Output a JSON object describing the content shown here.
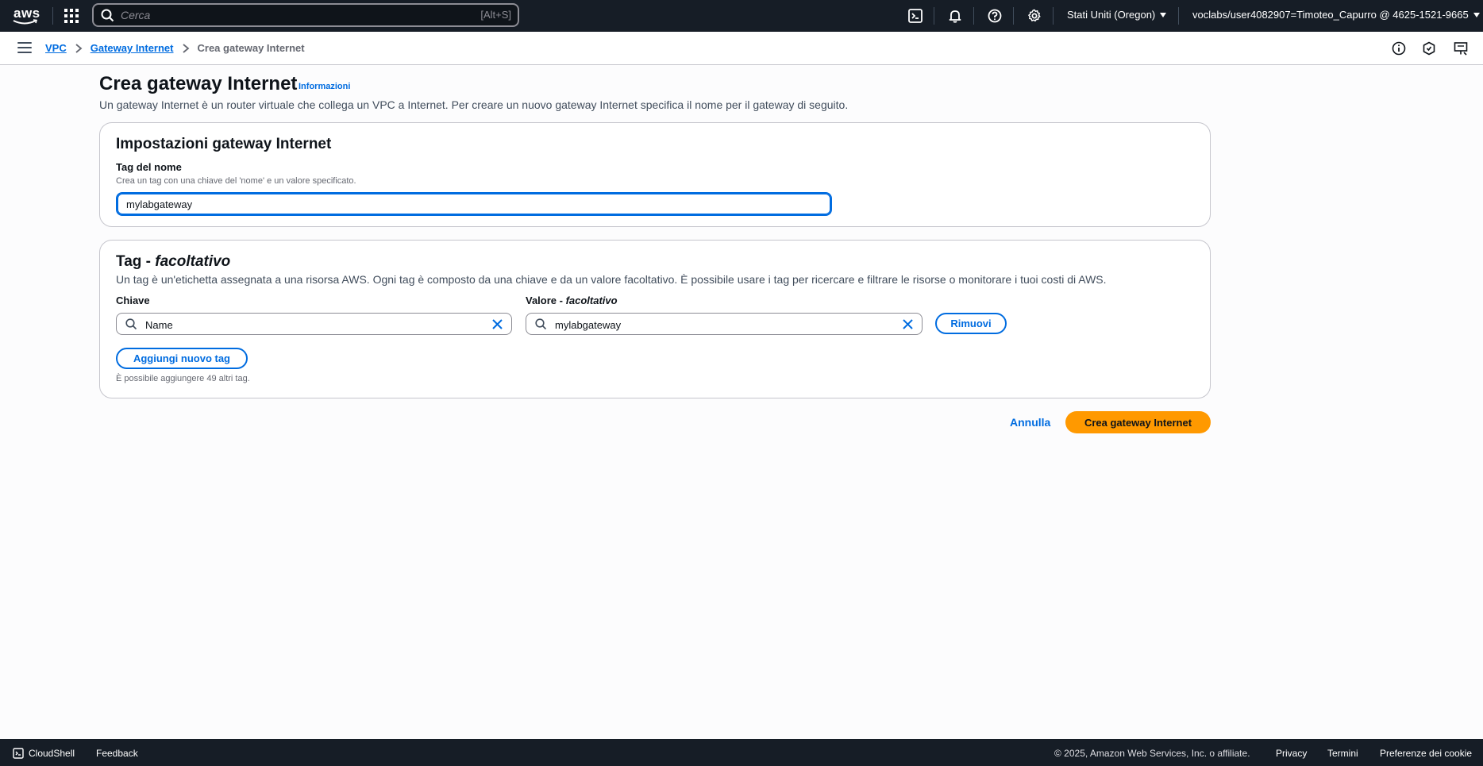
{
  "topnav": {
    "logo_text": "aws",
    "search_placeholder": "Cerca",
    "search_shortcut": "[Alt+S]",
    "region": "Stati Uniti (Oregon)",
    "account": "voclabs/user4082907=Timoteo_Capurro @ 4625-1521-9665",
    "icons": [
      "cloudshell-icon",
      "bell-icon",
      "help-icon",
      "settings-icon"
    ]
  },
  "breadcrumb": {
    "items": [
      "VPC",
      "Gateway Internet"
    ],
    "current": "Crea gateway Internet"
  },
  "page": {
    "title": "Crea gateway Internet",
    "info_link": "Informazioni",
    "description": "Un gateway Internet è un router virtuale che collega un VPC a Internet. Per creare un nuovo gateway Internet specifica il nome per il gateway di seguito."
  },
  "settings_panel": {
    "title": "Impostazioni gateway Internet",
    "name_tag_label": "Tag del nome",
    "name_tag_description": "Crea un tag con una chiave del 'nome' e un valore specificato.",
    "name_tag_value": "mylabgateway"
  },
  "tags_panel": {
    "title_prefix": "Tag - ",
    "title_optional": "facoltativo",
    "description": "Un tag è un'etichetta assegnata a una risorsa AWS. Ogni tag è composto da una chiave e da un valore facoltativo. È possibile usare i tag per ricercare e filtrare le risorse o monitorare i tuoi costi di AWS.",
    "key_label": "Chiave",
    "value_label_prefix": "Valore - ",
    "value_label_optional": "facoltativo",
    "tags": [
      {
        "key": "Name",
        "value": "mylabgateway"
      }
    ],
    "remove_button": "Rimuovi",
    "add_button": "Aggiungi nuovo tag",
    "remaining_hint": "È possibile aggiungere 49 altri tag."
  },
  "actions": {
    "cancel": "Annulla",
    "submit": "Crea gateway Internet"
  },
  "footer": {
    "cloudshell": "CloudShell",
    "feedback": "Feedback",
    "copyright": "© 2025, Amazon Web Services, Inc. o affiliate.",
    "privacy": "Privacy",
    "terms": "Termini",
    "cookies": "Preferenze dei cookie"
  },
  "colors": {
    "nav_bg": "#161d26",
    "link": "#006ce0",
    "primary": "#ff9900"
  }
}
